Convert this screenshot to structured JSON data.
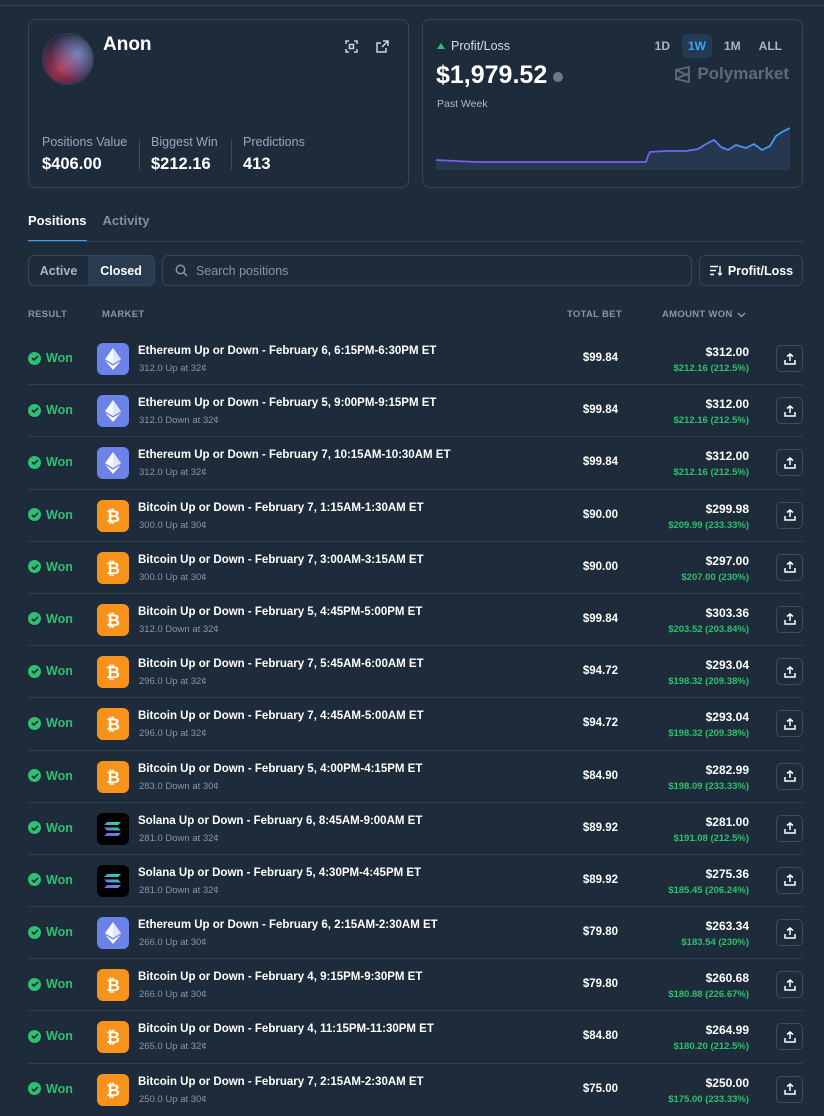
{
  "profile": {
    "name": "Anon",
    "stats": [
      {
        "label": "Positions Value",
        "value": "$406.00"
      },
      {
        "label": "Biggest Win",
        "value": "$212.16"
      },
      {
        "label": "Predictions",
        "value": "413"
      }
    ]
  },
  "pnl": {
    "label": "Profit/Loss",
    "value": "$1,979.52",
    "period": "Past Week",
    "ranges": [
      "1D",
      "1W",
      "1M",
      "ALL"
    ],
    "active_range": "1W",
    "brand": "Polymarket",
    "line_color": "#7b5cf0",
    "fill_color": "#3ba3f0"
  },
  "tabs": [
    {
      "label": "Positions",
      "active": true
    },
    {
      "label": "Activity",
      "active": false
    }
  ],
  "filters": {
    "segments": [
      {
        "label": "Active",
        "active": false
      },
      {
        "label": "Closed",
        "active": true
      }
    ],
    "search_placeholder": "Search positions",
    "sort_label": "Profit/Loss"
  },
  "table": {
    "headers": {
      "result": "RESULT",
      "market": "MARKET",
      "total_bet": "TOTAL BET",
      "amount_won": "AMOUNT WON"
    },
    "rows": [
      {
        "result": "Won",
        "coin": "eth",
        "title": "Ethereum Up or Down - February 6, 6:15PM-6:30PM ET",
        "sub": "312.0 Up at 32¢",
        "bet": "$99.84",
        "won": "$312.00",
        "gain": "$212.16 (212.5%)"
      },
      {
        "result": "Won",
        "coin": "eth",
        "title": "Ethereum Up or Down - February 5, 9:00PM-9:15PM ET",
        "sub": "312.0 Down at 32¢",
        "bet": "$99.84",
        "won": "$312.00",
        "gain": "$212.16 (212.5%)"
      },
      {
        "result": "Won",
        "coin": "eth",
        "title": "Ethereum Up or Down - February 7, 10:15AM-10:30AM ET",
        "sub": "312.0 Up at 32¢",
        "bet": "$99.84",
        "won": "$312.00",
        "gain": "$212.16 (212.5%)"
      },
      {
        "result": "Won",
        "coin": "btc",
        "title": "Bitcoin Up or Down - February 7, 1:15AM-1:30AM ET",
        "sub": "300.0 Up at 30¢",
        "bet": "$90.00",
        "won": "$299.98",
        "gain": "$209.99 (233.33%)"
      },
      {
        "result": "Won",
        "coin": "btc",
        "title": "Bitcoin Up or Down - February 7, 3:00AM-3:15AM ET",
        "sub": "300.0 Up at 30¢",
        "bet": "$90.00",
        "won": "$297.00",
        "gain": "$207.00 (230%)"
      },
      {
        "result": "Won",
        "coin": "btc",
        "title": "Bitcoin Up or Down - February 5, 4:45PM-5:00PM ET",
        "sub": "312.0 Down at 32¢",
        "bet": "$99.84",
        "won": "$303.36",
        "gain": "$203.52 (203.84%)"
      },
      {
        "result": "Won",
        "coin": "btc",
        "title": "Bitcoin Up or Down - February 7, 5:45AM-6:00AM ET",
        "sub": "296.0 Up at 32¢",
        "bet": "$94.72",
        "won": "$293.04",
        "gain": "$198.32 (209.38%)"
      },
      {
        "result": "Won",
        "coin": "btc",
        "title": "Bitcoin Up or Down - February 7, 4:45AM-5:00AM ET",
        "sub": "296.0 Up at 32¢",
        "bet": "$94.72",
        "won": "$293.04",
        "gain": "$198.32 (209.38%)"
      },
      {
        "result": "Won",
        "coin": "btc",
        "title": "Bitcoin Up or Down - February 5, 4:00PM-4:15PM ET",
        "sub": "283.0 Down at 30¢",
        "bet": "$84.90",
        "won": "$282.99",
        "gain": "$198.09 (233.33%)"
      },
      {
        "result": "Won",
        "coin": "sol",
        "title": "Solana Up or Down - February 6, 8:45AM-9:00AM ET",
        "sub": "281.0 Down at 32¢",
        "bet": "$89.92",
        "won": "$281.00",
        "gain": "$191.08 (212.5%)"
      },
      {
        "result": "Won",
        "coin": "sol",
        "title": "Solana Up or Down - February 5, 4:30PM-4:45PM ET",
        "sub": "281.0 Down at 32¢",
        "bet": "$89.92",
        "won": "$275.36",
        "gain": "$185.45 (206.24%)"
      },
      {
        "result": "Won",
        "coin": "eth",
        "title": "Ethereum Up or Down - February 6, 2:15AM-2:30AM ET",
        "sub": "266.0 Up at 30¢",
        "bet": "$79.80",
        "won": "$263.34",
        "gain": "$183.54 (230%)"
      },
      {
        "result": "Won",
        "coin": "btc",
        "title": "Bitcoin Up or Down - February 4, 9:15PM-9:30PM ET",
        "sub": "266.0 Up at 30¢",
        "bet": "$79.80",
        "won": "$260.68",
        "gain": "$180.88 (226.67%)"
      },
      {
        "result": "Won",
        "coin": "btc",
        "title": "Bitcoin Up or Down - February 4, 11:15PM-11:30PM ET",
        "sub": "265.0 Up at 32¢",
        "bet": "$84.80",
        "won": "$264.99",
        "gain": "$180.20 (212.5%)"
      },
      {
        "result": "Won",
        "coin": "btc",
        "title": "Bitcoin Up or Down - February 7, 2:15AM-2:30AM ET",
        "sub": "250.0 Up at 30¢",
        "bet": "$75.00",
        "won": "$250.00",
        "gain": "$175.00 (233.33%)"
      }
    ]
  }
}
